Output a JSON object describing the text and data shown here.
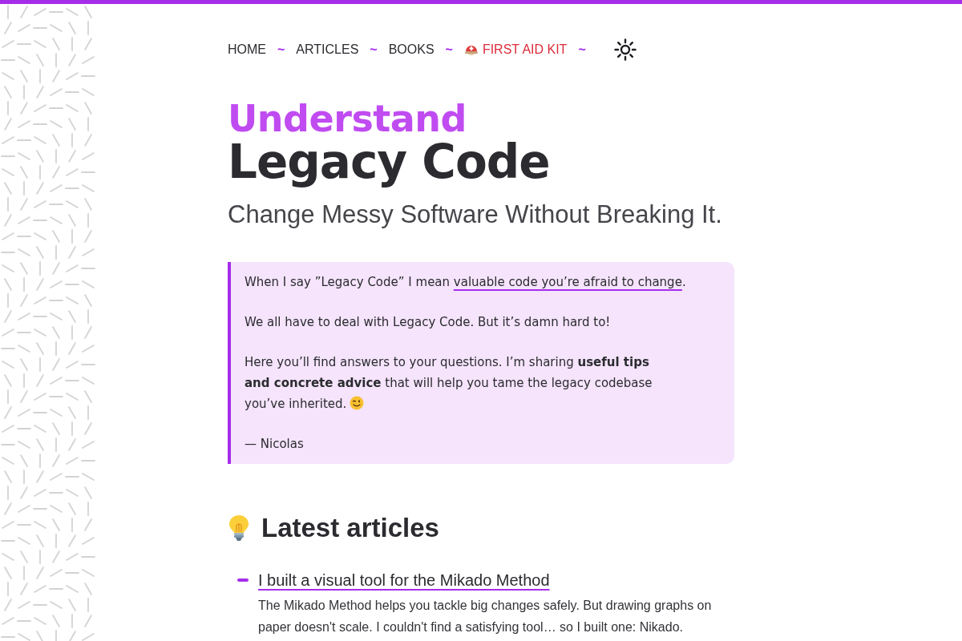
{
  "nav": {
    "items": [
      {
        "kind": "link",
        "label": "HOME"
      },
      {
        "kind": "separator",
        "label": "~"
      },
      {
        "kind": "link",
        "label": "ARTICLES"
      },
      {
        "kind": "separator",
        "label": "~"
      },
      {
        "kind": "link",
        "label": "BOOKS"
      },
      {
        "kind": "separator",
        "label": "~"
      },
      {
        "kind": "urgent",
        "label": "FIRST AID KIT"
      },
      {
        "kind": "separator",
        "label": "~"
      }
    ]
  },
  "hero": {
    "title_accent": "Understand",
    "title": "Legacy Code",
    "subtitle": "Change Messy Software Without Breaking It."
  },
  "intro": {
    "paragraphs": [
      {
        "kind": "link",
        "before": "When I say ”Legacy Code” I mean ",
        "link": "valuable code you’re afraid to change",
        "after": "."
      },
      {
        "kind": "plain",
        "lines": [
          "We all have to deal with Legacy Code. But it’s damn hard to!"
        ]
      },
      {
        "kind": "wink",
        "lines": [
          "Here you’ll find answers to your questions. I’m sharing **useful tips**",
          "**and concrete advice** that will help you tame the legacy codebase",
          "you’ve inherited."
        ]
      }
    ],
    "signature": "— Nicolas"
  },
  "latest": {
    "heading": "Latest articles",
    "articles": [
      {
        "title": "I built a visual tool for the Mikado Method",
        "summary": "The Mikado Method helps you tackle big changes safely. But drawing graphs on paper doesn't scale. I couldn't find a satisfying tool… so I built one: Nikado."
      }
    ]
  }
}
